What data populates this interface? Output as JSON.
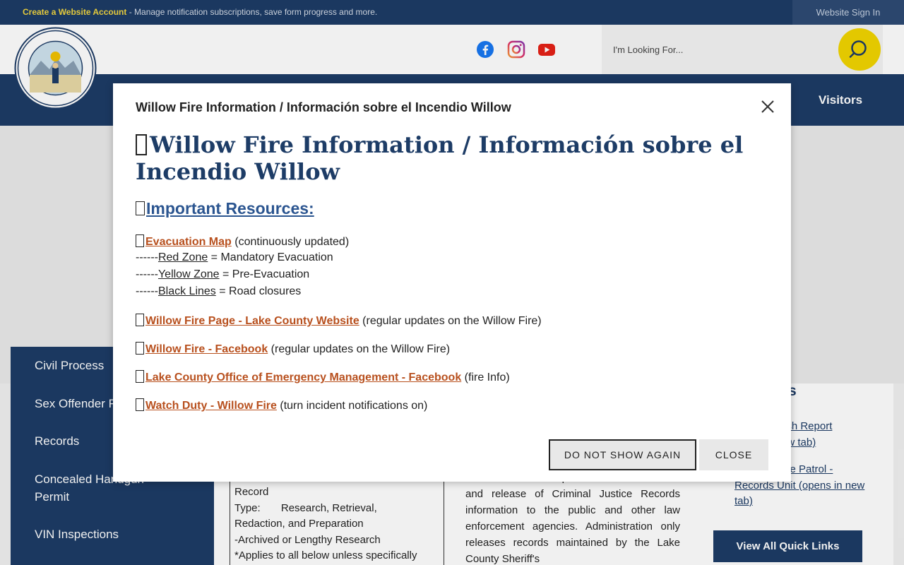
{
  "topbar": {
    "account_link": "Create a Website Account",
    "account_desc": " - Manage notification subscriptions, save form progress and more.",
    "signin": "Website Sign In"
  },
  "header": {
    "search_placeholder": "I'm Looking For..."
  },
  "nav": {
    "visitors": "Visitors"
  },
  "sidebar": {
    "items": [
      "Civil Process",
      "Sex Offender R",
      "Records",
      "Concealed Handgun Permit",
      "VIN Inspections"
    ]
  },
  "content": {
    "table_lines": [
      "Record",
      "Type:       Research, Retrieval,",
      "Redaction, and Preparation",
      "-Archived or Lengthy Research",
      "*Applies to all below unless specifically"
    ],
    "mid_paragraph": "Administration is responsible for the retention and release of Criminal Justice Records information to the public and other law enforcement agencies. Administration only releases records maintained by the Lake County Sheriff's",
    "quick_title": "s",
    "quick_links": [
      "rash Report",
      "ew tab)",
      "ate Patrol -",
      "Records Unit (opens in new",
      "tab)"
    ],
    "view_all": "View All Quick Links"
  },
  "modal": {
    "title": "Willow Fire Information / Información sobre el Incendio Willow",
    "heading": "Willow Fire Information / Información sobre el Incendio Willow",
    "subheading": "Important Resources:",
    "evac_link": "Evacuation Map",
    "evac_note": " (continuously updated)",
    "zone_prefix": "------",
    "red_zone": "Red Zone",
    "red_desc": " = Mandatory Evacuation",
    "yellow_zone": "Yellow Zone",
    "yellow_desc": " = Pre-Evacuation",
    "black_lines": "Black Lines",
    "black_desc": " = Road closures",
    "link_page": "Willow Fire Page - Lake County Website",
    "link_page_note": " (regular updates on the Willow Fire)",
    "link_fb": "Willow Fire - Facebook",
    "link_fb_note": " (regular updates on the Willow Fire)",
    "link_oem": "Lake County Office of Emergency Management - Facebook",
    "link_oem_note": " (fire Info)",
    "link_watch": "Watch Duty - Willow Fire",
    "link_watch_note": " (turn incident notifications on)",
    "btn_dont_show": "DO NOT SHOW AGAIN",
    "btn_close": "CLOSE"
  },
  "colors": {
    "navy": "#1d3c66",
    "accent_yellow": "#f2d500",
    "link_orange": "#b8501e",
    "link_blue": "#2b5590"
  }
}
